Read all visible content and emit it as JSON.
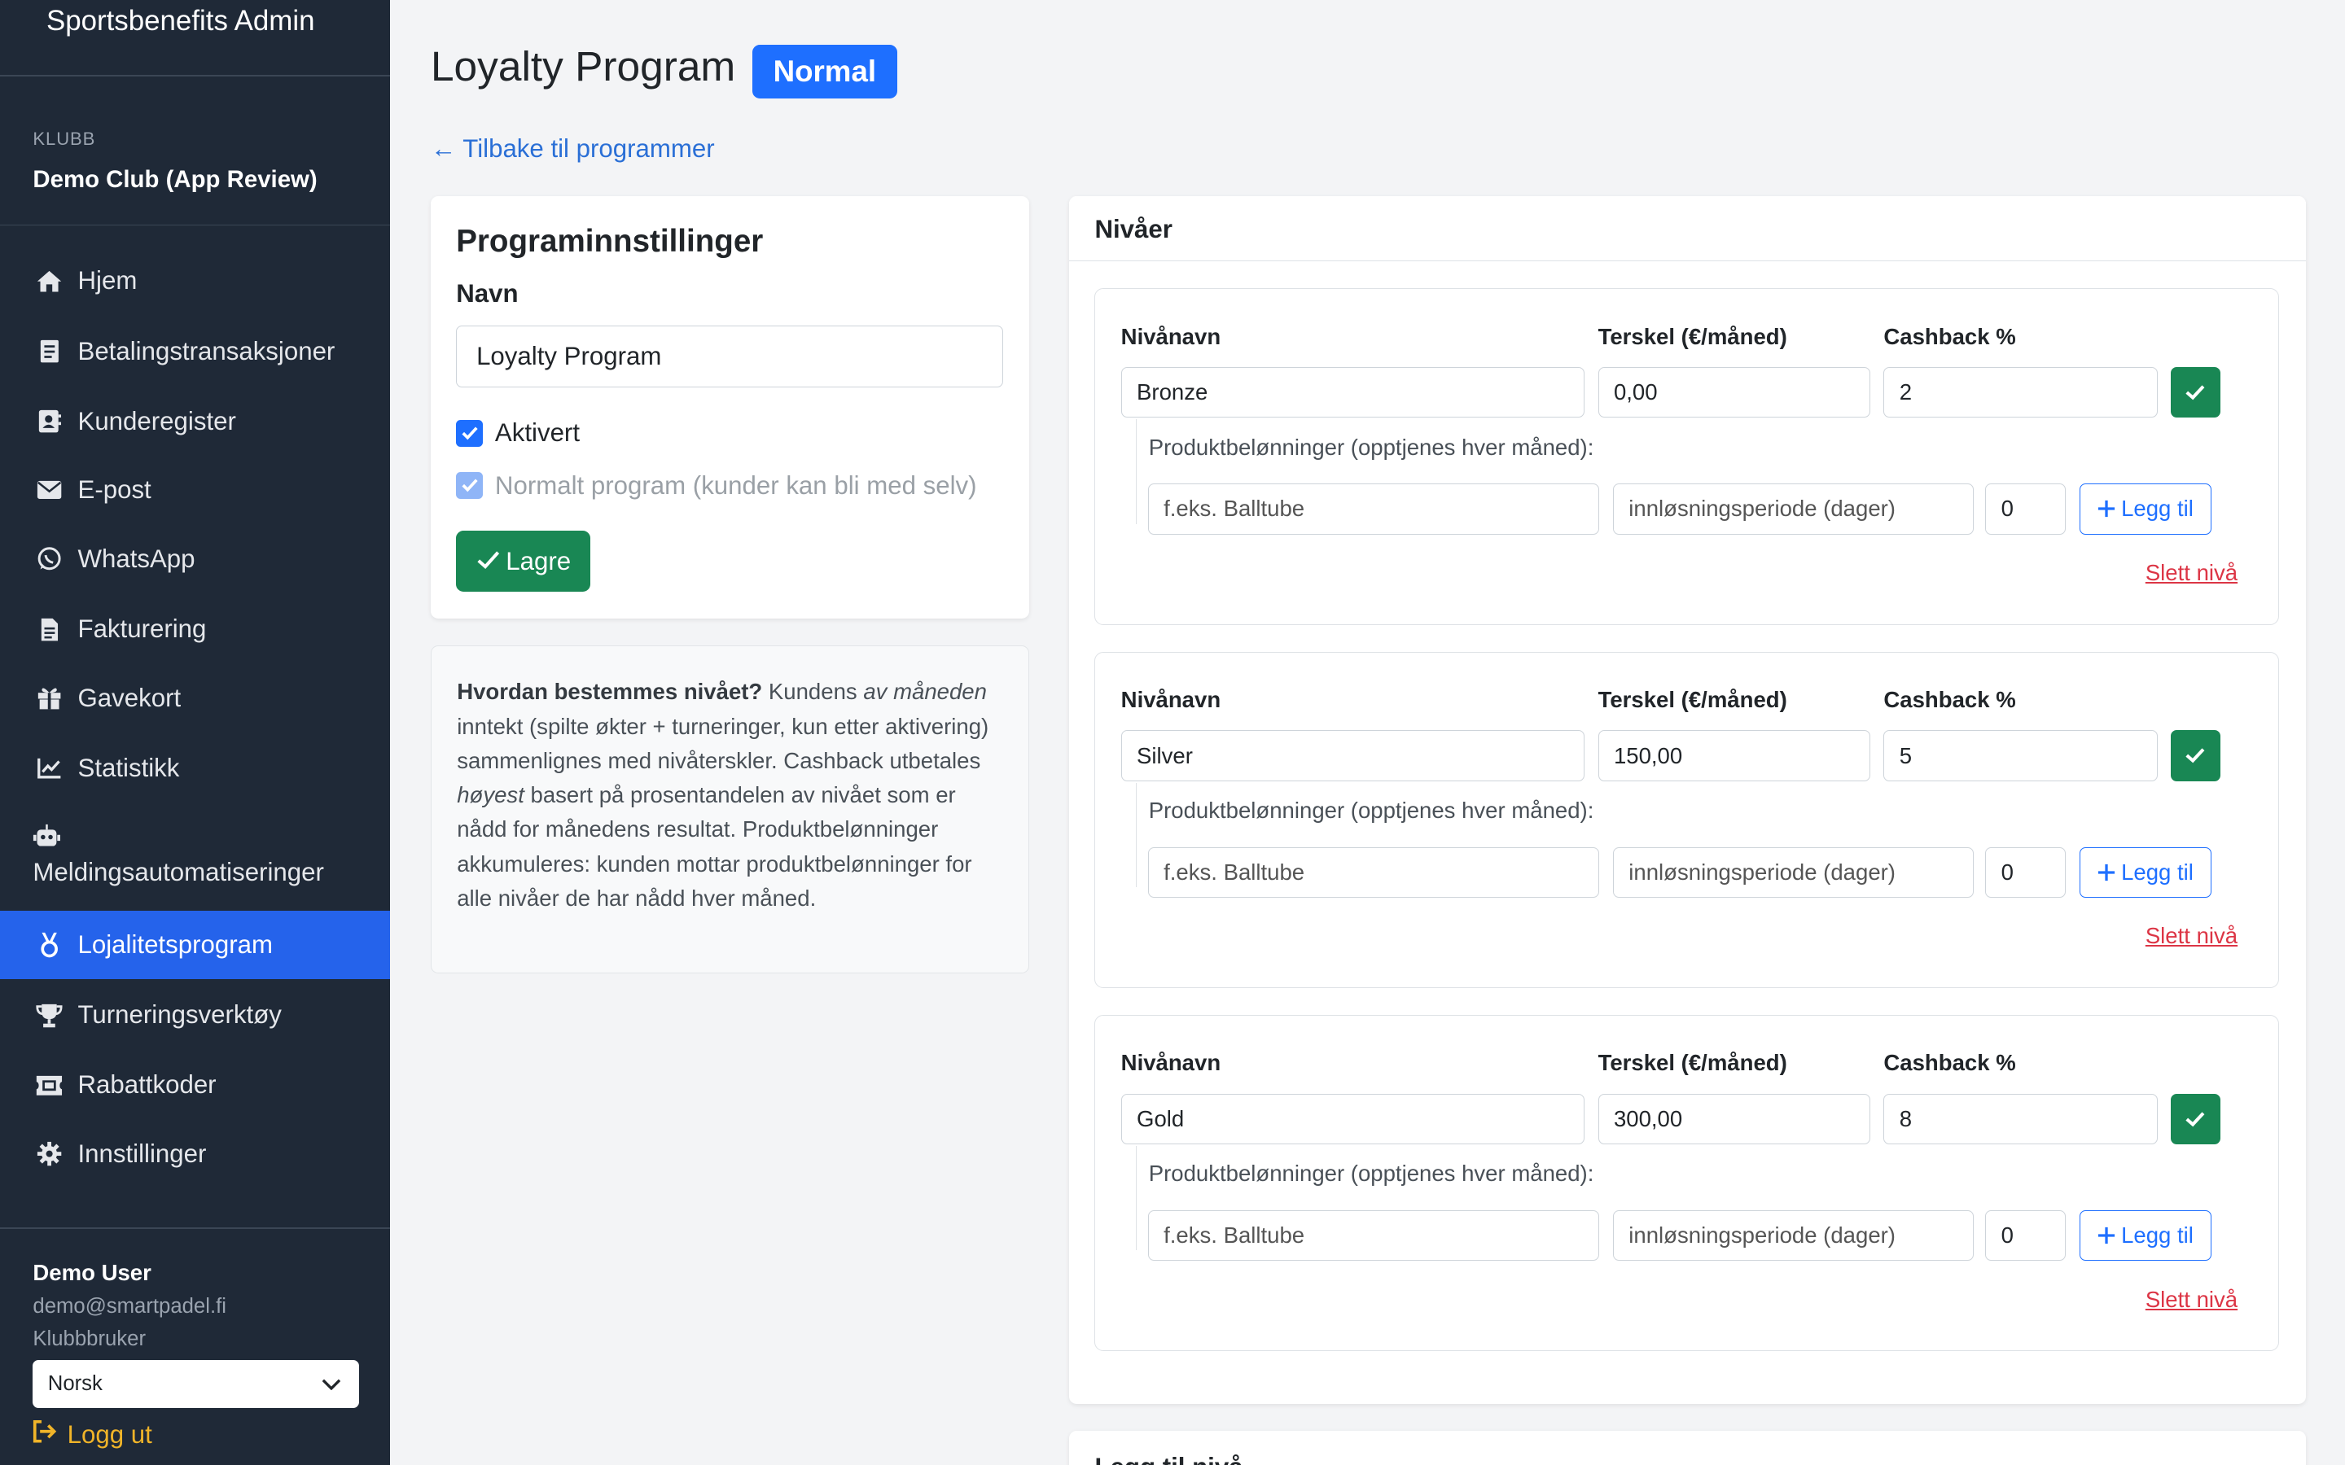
{
  "sidebar": {
    "brand": "Sportsbenefits Admin",
    "club_label": "KLUBB",
    "club_name": "Demo Club (App Review)",
    "items": [
      {
        "label": "Hjem",
        "icon": "home-icon"
      },
      {
        "label": "Betalingstransaksjoner",
        "icon": "receipt-icon"
      },
      {
        "label": "Kunderegister",
        "icon": "contact-card-icon"
      },
      {
        "label": "E-post",
        "icon": "envelope-icon"
      },
      {
        "label": "WhatsApp",
        "icon": "whatsapp-icon"
      },
      {
        "label": "Fakturering",
        "icon": "invoice-icon"
      },
      {
        "label": "Gavekort",
        "icon": "gift-icon"
      },
      {
        "label": "Statistikk",
        "icon": "chart-line-icon"
      },
      {
        "label": "Meldingsautomatiseringer",
        "icon": "robot-icon"
      },
      {
        "label": "Lojalitetsprogram",
        "icon": "medal-icon",
        "active": true
      },
      {
        "label": "Turneringsverktøy",
        "icon": "trophy-icon"
      },
      {
        "label": "Rabattkoder",
        "icon": "ticket-icon"
      },
      {
        "label": "Innstillinger",
        "icon": "gear-icon"
      }
    ],
    "user": {
      "name": "Demo User",
      "email": "demo@smartpadel.fi",
      "role": "Klubbbruker"
    },
    "language": "Norsk",
    "logout": "Logg ut"
  },
  "header": {
    "title": "Loyalty Program",
    "badge": "Normal",
    "back_link": "← Tilbake til programmer"
  },
  "settings": {
    "heading": "Programinnstillinger",
    "name_label": "Navn",
    "name_value": "Loyalty Program",
    "enabled_label": "Aktivert",
    "normal_label": "Normalt program (kunder kan bli med selv)",
    "save_label": "Lagre"
  },
  "info": {
    "question": "Hvordan bestemmes nivået?",
    "t1": " Kundens ",
    "t2": "av måneden",
    "t3": " inntekt (spilte økter + turneringer, kun etter aktivering) sammenlignes med nivåterskler. Cashback utbetales ",
    "t4": "høyest",
    "t5": " basert på prosentandelen av nivået som er nådd for månedens resultat. Produktbelønninger akkumuleres: kunden mottar produktbelønninger for alle nivåer de har nådd hver måned."
  },
  "levels": {
    "heading": "Nivåer",
    "col_name": "Nivånavn",
    "col_threshold": "Terskel (€/måned)",
    "col_cashback": "Cashback %",
    "rewards_label": "Produktbelønninger (opptjenes hver måned):",
    "reward_placeholder": "f.eks. Balltube",
    "period_placeholder": "innløsningsperiode (dager)",
    "qty_value": "0",
    "add_label": "Legg til",
    "delete_label": "Slett nivå",
    "tiers": [
      {
        "name": "Bronze",
        "threshold": "0,00",
        "cashback": "2"
      },
      {
        "name": "Silver",
        "threshold": "150,00",
        "cashback": "5"
      },
      {
        "name": "Gold",
        "threshold": "300,00",
        "cashback": "8"
      }
    ]
  },
  "next_card": {
    "title": "Legg til nivå"
  }
}
